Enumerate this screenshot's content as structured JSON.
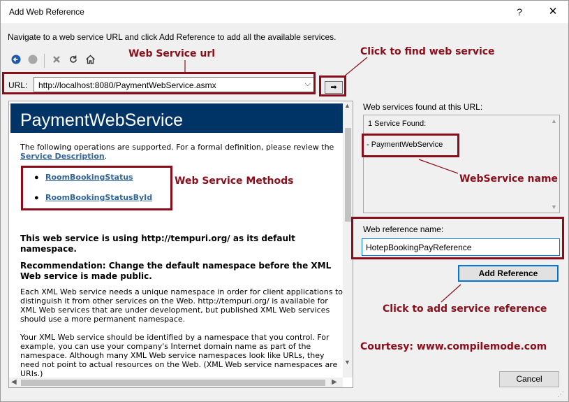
{
  "window": {
    "title": "Add Web Reference",
    "help_label": "?",
    "close_label": "✕"
  },
  "instructions": "Navigate to a web service URL and click Add Reference to add all the available services.",
  "toolbar": {
    "icons": [
      "back-icon",
      "stop-icon",
      "cancel-icon",
      "refresh-icon",
      "home-icon"
    ]
  },
  "url": {
    "label": "URL:",
    "value": "http://localhost:8080/PaymentWebService.asmx",
    "go_label": "➡"
  },
  "browser": {
    "service_title": "PaymentWebService",
    "intro": "The following operations are supported. For a formal definition, please review the",
    "service_description_link": "Service Description",
    "intro_end": ".",
    "methods": [
      "RoomBookingStatus",
      "RoomBookingStatusById"
    ],
    "namespace_heading": "This web service is using http://tempuri.org/ as its default namespace.",
    "recommendation_heading": "Recommendation: Change the default namespace before the XML Web service is made public.",
    "para1": "Each XML Web service needs a unique namespace in order for client applications to distinguish it from other services on the Web. http://tempuri.org/ is available for XML Web services that are under development, but published XML Web services should use a more permanent namespace.",
    "para2": "Your XML Web service should be identified by a namespace that you control. For example, you can use your company's Internet domain name as part of the namespace. Although many XML Web service namespaces look like URLs, they need not point to actual resources on the Web. (XML Web service namespaces are URIs.)"
  },
  "services": {
    "label": "Web services found at this URL:",
    "count_text": "1 Service Found:",
    "items": [
      "- PaymentWebService"
    ]
  },
  "reference": {
    "label": "Web reference name:",
    "value": "HotepBookingPayReference"
  },
  "buttons": {
    "add_reference": "Add Reference",
    "cancel": "Cancel"
  },
  "annotations": {
    "web_service_url": "Web Service url",
    "click_find": "Click to find web service",
    "web_service_methods": "Web Service Methods",
    "webservice_name": "WebService name",
    "click_add": "Click to add service reference",
    "courtesy": "Courtesy: www.compilemode.com"
  },
  "colors": {
    "annotation": "#8b0d19",
    "header_bg": "#003366",
    "link": "#336699",
    "focus_border": "#0078d7"
  }
}
